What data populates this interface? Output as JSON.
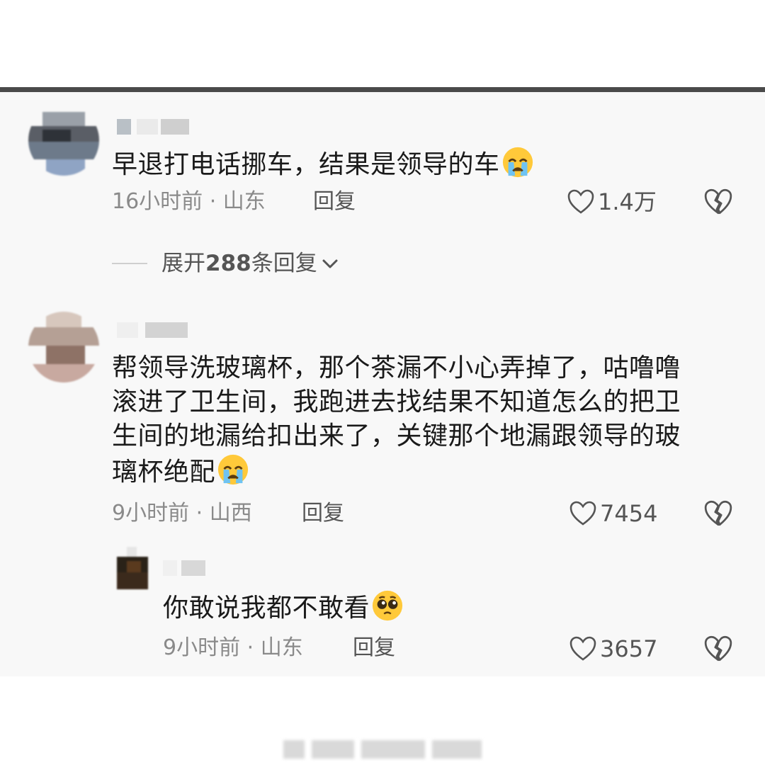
{
  "comments": [
    {
      "text": "早退打电话挪车，结果是领导的车",
      "emoji": "crying-face-emoji",
      "time": "16小时前 · 山东",
      "reply_label": "回复",
      "likes": "1.4万",
      "expand": {
        "prefix": "展开",
        "count": "288",
        "suffix": "条回复"
      }
    },
    {
      "lines": [
        "帮领导洗玻璃杯，那个茶漏不小心弄掉了，咕噜噜",
        "滚进了卫生间，我跑进去找结果不知道怎么的把卫",
        "生间的地漏给扣出来了，关键那个地漏跟领导的玻",
        "璃杯绝配"
      ],
      "emoji": "crying-face-emoji",
      "time": "9小时前 · 山西",
      "reply_label": "回复",
      "likes": "7454"
    }
  ],
  "reply": {
    "text": "你敢说我都不敢看",
    "emoji": "pleading-face-emoji",
    "time": "9小时前 · 山东",
    "reply_label": "回复",
    "likes": "3657"
  },
  "colors": {
    "text": "#1a1a1a",
    "meta": "#8a8a8a",
    "divider": "#4a4a4a",
    "card": "#f8f8f8"
  }
}
